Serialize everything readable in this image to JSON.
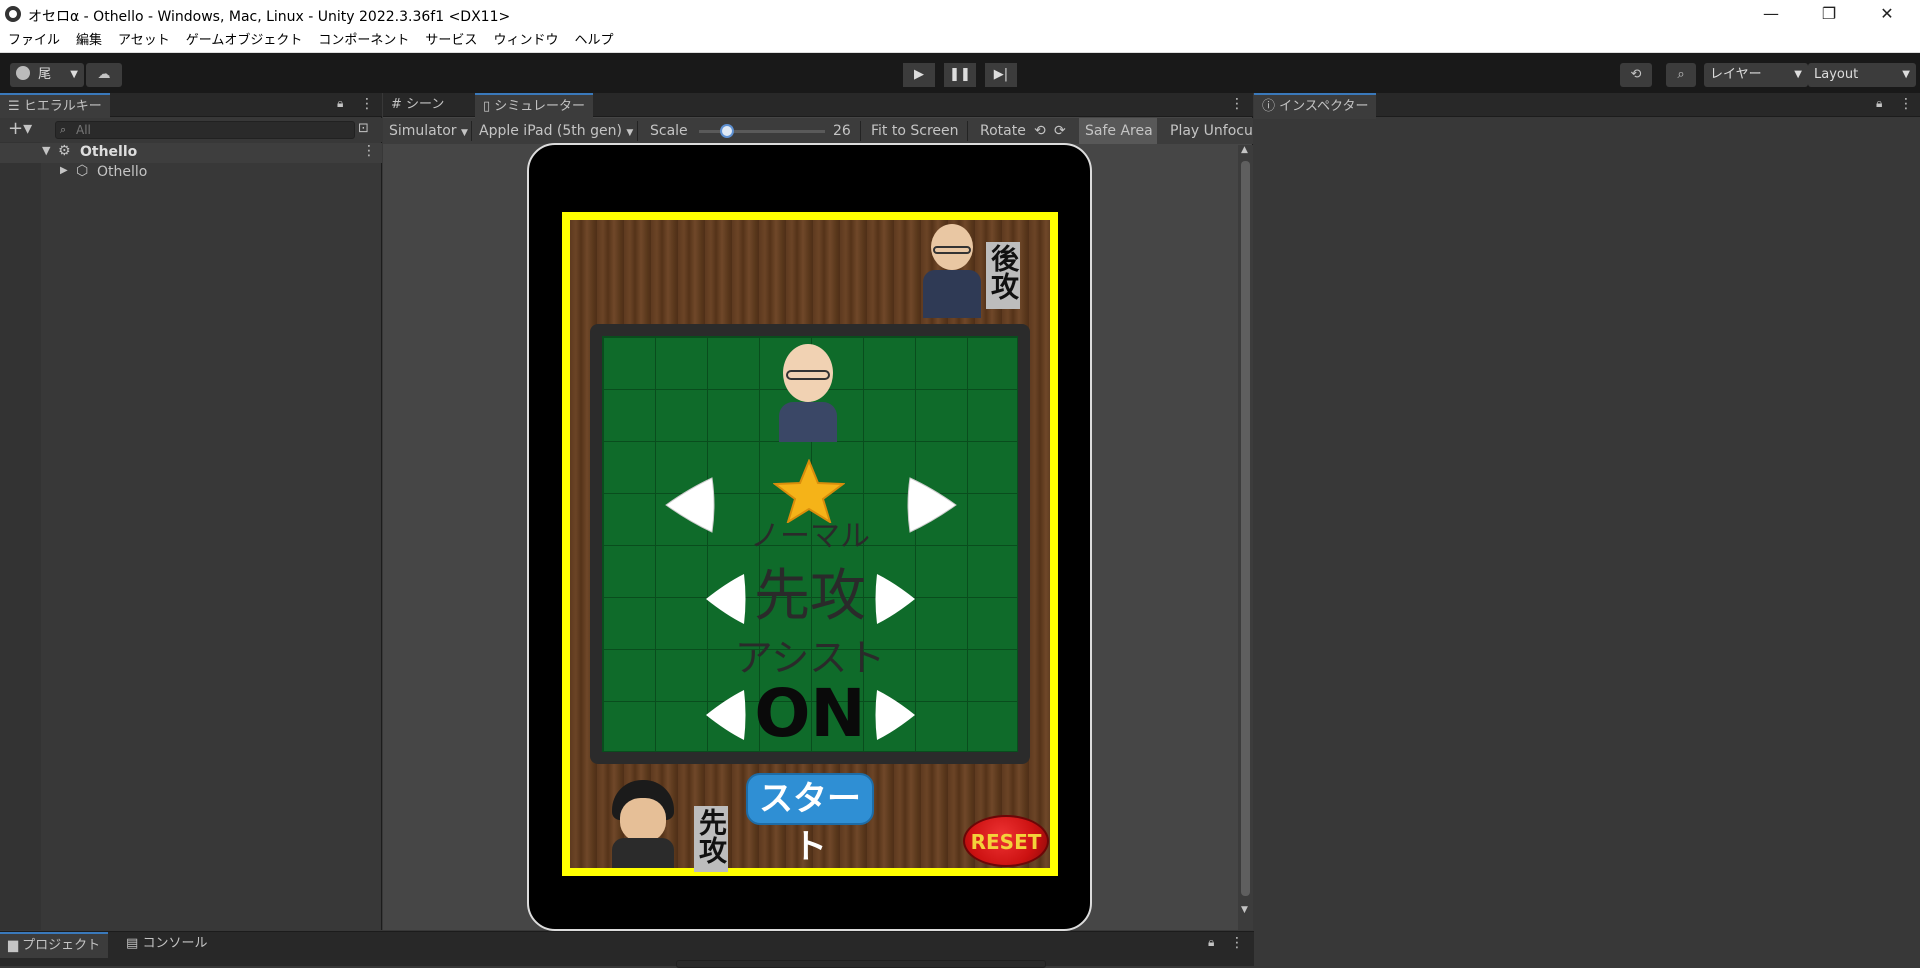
{
  "window": {
    "title": "オセロα - Othello - Windows, Mac, Linux - Unity 2022.3.36f1 <DX11>",
    "minimize": "—",
    "maximize": "❐",
    "close": "✕"
  },
  "menu": [
    "ファイル",
    "編集",
    "アセット",
    "ゲームオブジェクト",
    "コンポーネント",
    "サービス",
    "ウィンドウ",
    "ヘルプ"
  ],
  "toolbar": {
    "account_label": "尾",
    "layers_label": "レイヤー",
    "layout_label": "Layout"
  },
  "hierarchy": {
    "tab_label": "ヒエラルキー",
    "search_placeholder": "All",
    "scene_name": "Othello",
    "child_name": "Othello"
  },
  "center": {
    "scene_tab": "シーン",
    "simulator_tab": "シミュレーター",
    "simulator_dropdown": "Simulator",
    "device_dropdown": "Apple iPad (5th gen)",
    "scale_label": "Scale",
    "scale_value": "26",
    "scale_fraction": 0.22,
    "fit_to_screen": "Fit to Screen",
    "rotate": "Rotate",
    "safe_area": "Safe Area",
    "play_unfocused": "Play Unfocu"
  },
  "game": {
    "second_player_label": "後攻",
    "first_player_label": "先攻",
    "difficulty": "ノーマル",
    "turn_order": "先攻",
    "assist_label": "アシスト",
    "assist_value": "ON",
    "start_button": "スタート",
    "reset_button": "RESET"
  },
  "inspector": {
    "tab_label": "インスペクター"
  },
  "bottom": {
    "project_tab": "プロジェクト",
    "console_tab": "コンソール"
  }
}
